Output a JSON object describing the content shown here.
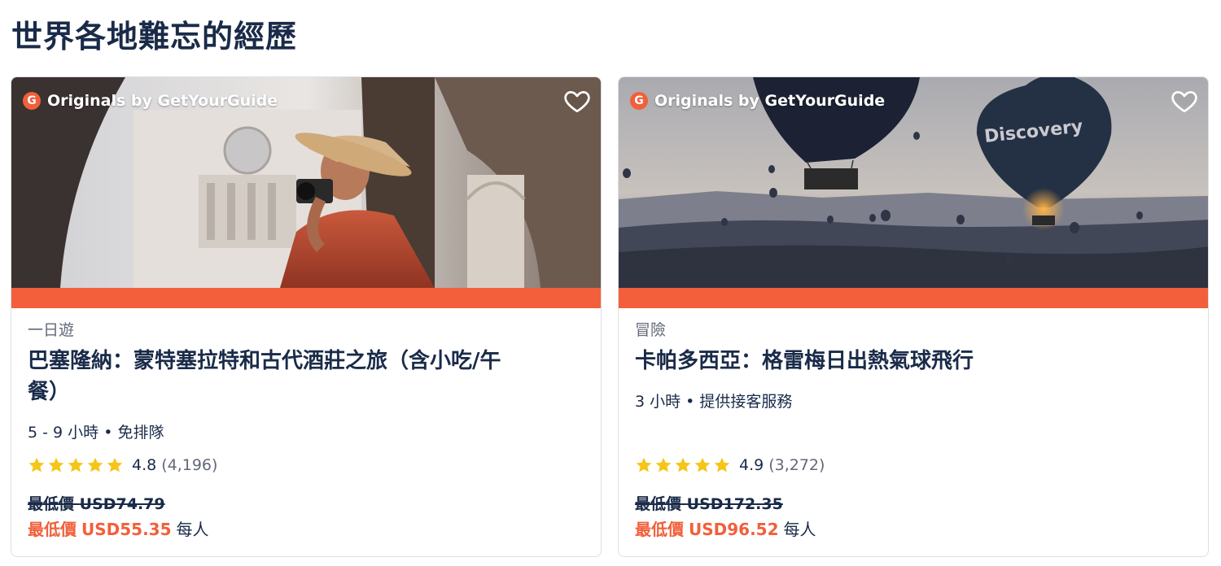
{
  "section": {
    "title": "世界各地難忘的經歷"
  },
  "colors": {
    "accent": "#f25f3a",
    "star": "#f5c518",
    "text": "#1a2b49",
    "muted": "#63687a"
  },
  "cards": [
    {
      "badge": "Originals by GetYourGuide",
      "badge_logo": "G",
      "heart_icon": "heart-outline-icon",
      "category": "一日遊",
      "title": "巴塞隆納：蒙特塞拉特和古代酒莊之旅（含小吃/午餐）",
      "title_line1": "巴塞隆納：蒙特塞拉特和古代酒莊之旅（含小吃/午",
      "title_line2": "餐）",
      "details": "5 - 9 小時 • 免排隊",
      "rating": 4.8,
      "rating_text": "4.8",
      "reviews": "(4,196)",
      "stars": 5,
      "old_price_label": "最低價",
      "old_price": "USD74.79",
      "new_price_label": "最低價",
      "new_price": "USD55.35",
      "per_person": "每人"
    },
    {
      "badge": "Originals by GetYourGuide",
      "badge_logo": "G",
      "heart_icon": "heart-outline-icon",
      "category": "冒險",
      "title": "卡帕多西亞：格雷梅日出熱氣球飛行",
      "details": "3 小時 • 提供接客服務",
      "rating": 4.9,
      "rating_text": "4.9",
      "reviews": "(3,272)",
      "stars": 5,
      "old_price_label": "最低價",
      "old_price": "USD172.35",
      "new_price_label": "最低價",
      "new_price": "USD96.52",
      "per_person": "每人"
    }
  ]
}
